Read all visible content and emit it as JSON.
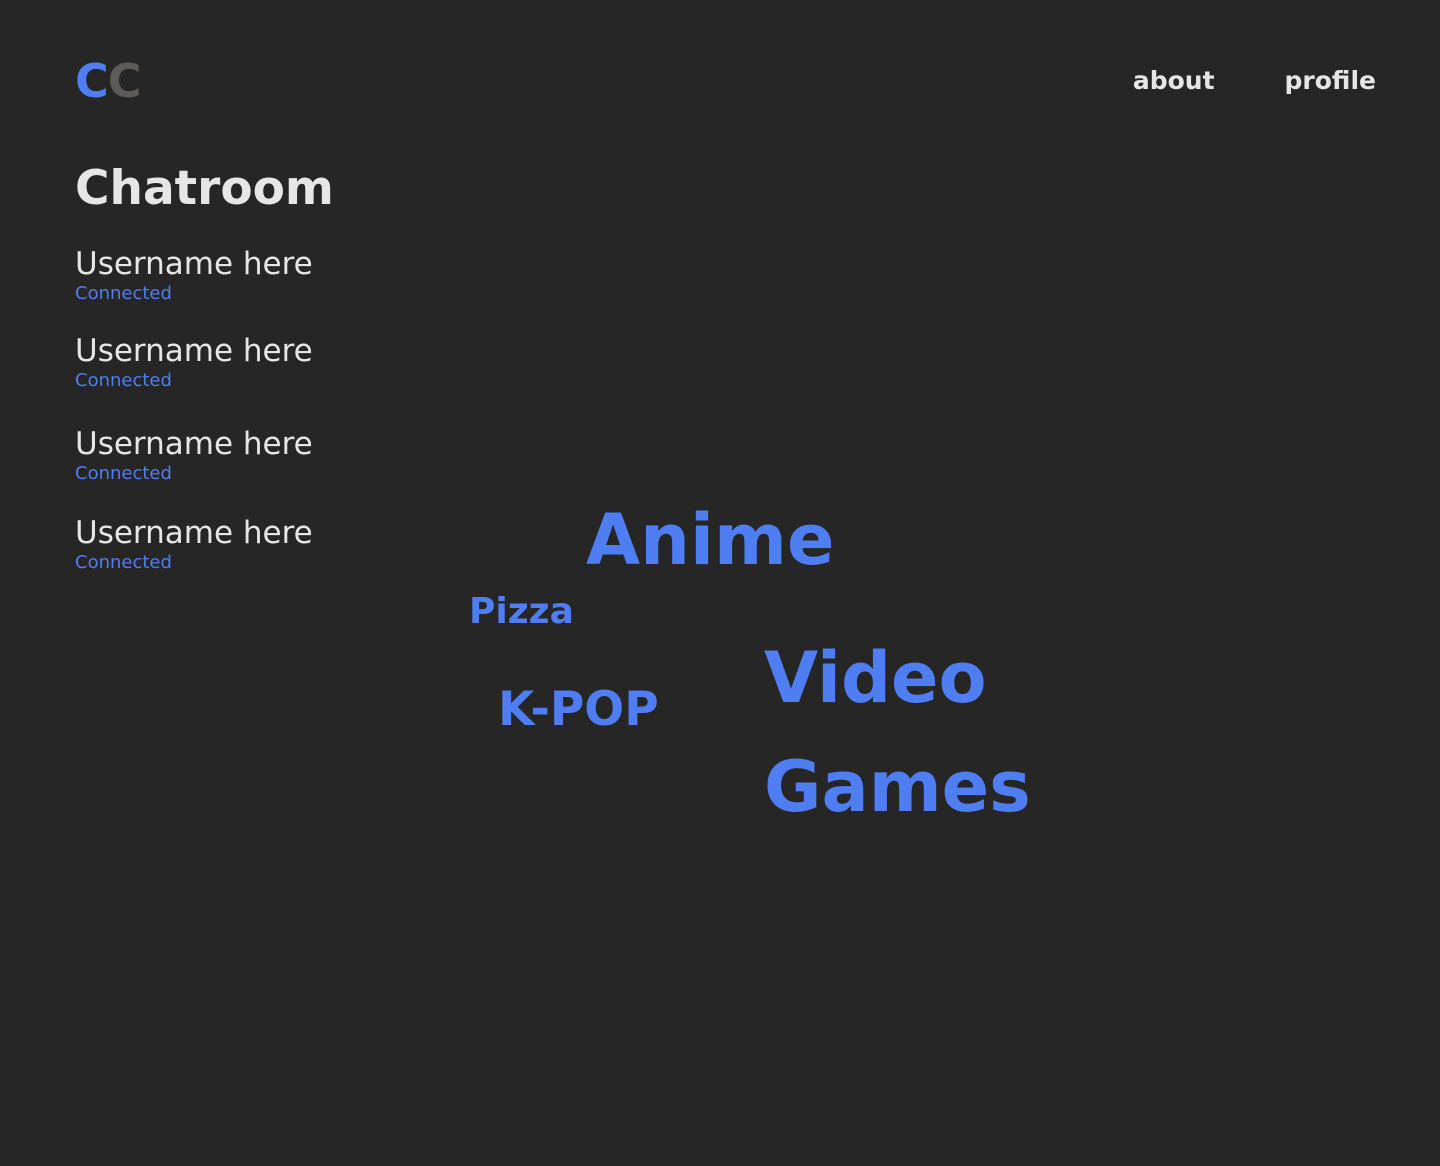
{
  "logo": {
    "letter_1": "C",
    "letter_2": "C"
  },
  "nav": {
    "about": "about",
    "profile": "profile"
  },
  "page_title": "Chatroom",
  "users": [
    {
      "name": "Username here",
      "status": "Connected"
    },
    {
      "name": "Username here",
      "status": "Connected"
    },
    {
      "name": "Username here",
      "status": "Connected"
    },
    {
      "name": "Username here",
      "status": "Connected"
    }
  ],
  "topics": {
    "anime": "Anime",
    "pizza": "Pizza",
    "kpop": "K-POP",
    "video": "Video",
    "games": "Games"
  },
  "colors": {
    "background": "#262626",
    "accent": "#4f7ef3",
    "text": "#e6e6e6",
    "logo_secondary": "#5f5a58"
  }
}
